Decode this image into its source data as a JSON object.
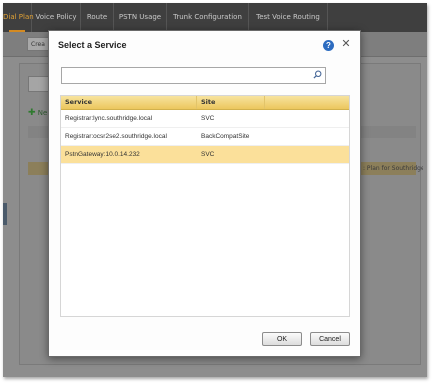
{
  "app": {
    "tabs": [
      {
        "label": "Dial Plan"
      },
      {
        "label": "Voice Policy"
      },
      {
        "label": "Route"
      },
      {
        "label": "PSTN Usage"
      },
      {
        "label": "Trunk Configuration"
      },
      {
        "label": "Test Voice Routing"
      }
    ],
    "active_tab_index": 0,
    "toolbar_button_label": "Crea",
    "new_label": "Ne",
    "selected_row_text": ": Plan for Southridge..."
  },
  "modal": {
    "title": "Select a Service",
    "search": {
      "value": "",
      "placeholder": ""
    },
    "columns": [
      "Service",
      "Site"
    ],
    "rows": [
      {
        "service": "Registrar:lync.southridge.local",
        "site": "SVC",
        "selected": false
      },
      {
        "service": "Registrar:ocsr2se2.southridge.local",
        "site": "BackCompatSite",
        "selected": false
      },
      {
        "service": "PstnGateway:10.0.14.232",
        "site": "SVC",
        "selected": true
      }
    ],
    "ok_label": "OK",
    "cancel_label": "Cancel",
    "help_glyph": "?",
    "close_glyph": "✕"
  },
  "colors": {
    "accent": "#d48a21",
    "header_gold": "#ecc75e",
    "selected_row": "#fbe09a",
    "help_blue": "#2d6cc0"
  },
  "icons": [
    "help-icon",
    "close-icon",
    "search-icon",
    "add-icon"
  ]
}
